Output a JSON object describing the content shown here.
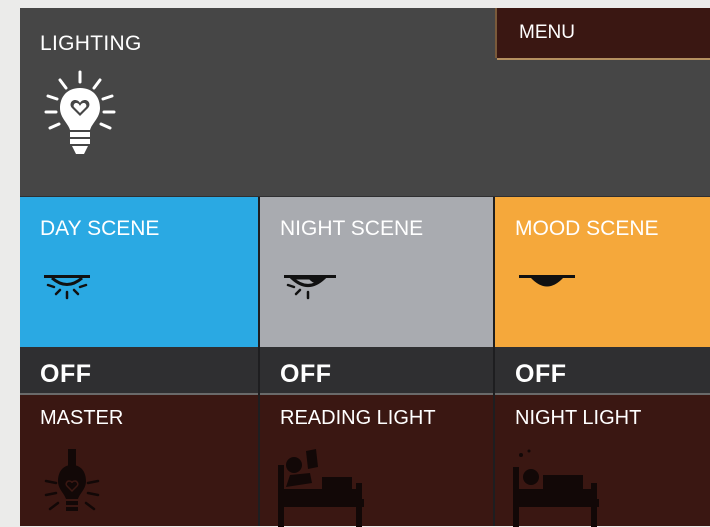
{
  "header": {
    "title": "LIGHTING",
    "icon": "lightbulb-heart-icon"
  },
  "menu": {
    "label": "MENU"
  },
  "scenes": [
    {
      "label": "DAY SCENE",
      "color": "#2aa9e3",
      "icon": "ceiling-light-on-icon"
    },
    {
      "label": "NIGHT SCENE",
      "color": "#a9abb0",
      "icon": "ceiling-light-half-icon"
    },
    {
      "label": "MOOD SCENE",
      "color": "#f5a83b",
      "icon": "ceiling-light-off-icon"
    }
  ],
  "states": [
    "OFF",
    "OFF",
    "OFF"
  ],
  "lights": [
    {
      "label": "MASTER",
      "icon": "master-bulb-icon"
    },
    {
      "label": "READING LIGHT",
      "icon": "reading-in-bed-icon"
    },
    {
      "label": "NIGHT LIGHT",
      "icon": "sleeping-in-bed-icon"
    }
  ],
  "colors": {
    "panel": "#464646",
    "tile_dark": "#3a1712",
    "text": "#ffffff"
  }
}
